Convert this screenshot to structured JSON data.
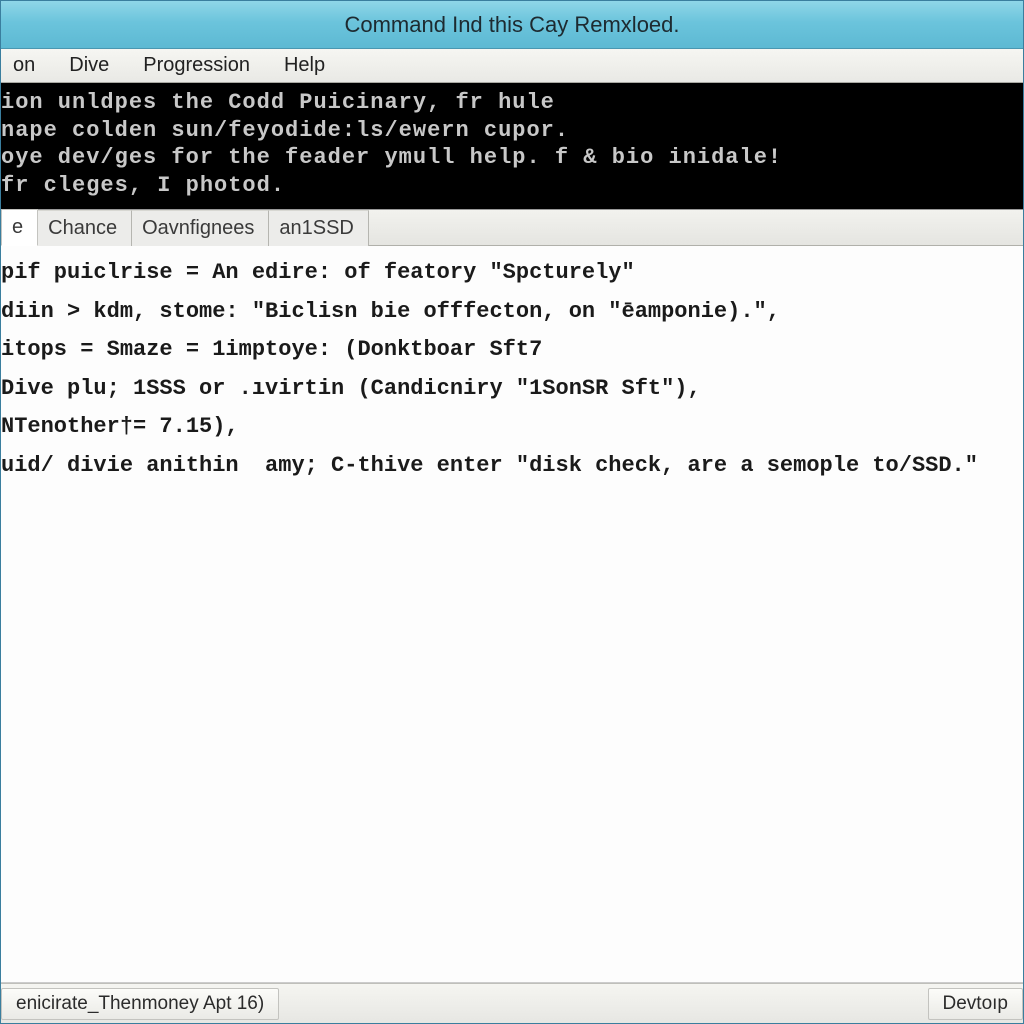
{
  "titlebar": {
    "text": "Command Ind this Cay Remxloed."
  },
  "menubar": {
    "items": [
      "on",
      "Dive",
      "Progression",
      "Help"
    ]
  },
  "console": {
    "lines": [
      "ion unldpes the Codd Puicinary, fr hule",
      "nape colden sun/feyodide:ls/ewern cupor.",
      "oye dev/ges for the feader ymull help. f & bio inidale!",
      "fr cleges, I photod."
    ]
  },
  "tabs": {
    "items": [
      "e",
      "Chance",
      "Oavnfignees",
      "an1SSD"
    ],
    "active_index": 0
  },
  "editor": {
    "lines": [
      "pif puiclrise = An edire: of featory \"Spcturely\"",
      "diin > kdm, stome: \"Biclisn bie offfecton, on \"ēamponie).\",",
      "itops = Smaze = 1imptoye: (Donktboar Sft7",
      "Dive plu; 1SSS or .ıvirtin (Candicniry \"1SonSR Sft\"),",
      "NTenother†= 7.15),",
      "uid/ divie anithin  amy; C-thive enter \"disk check, are a semople to/SSD.\""
    ]
  },
  "statusbar": {
    "left": "enicirate_Thenmoney Apt 16)",
    "right": "Devtoıp"
  }
}
